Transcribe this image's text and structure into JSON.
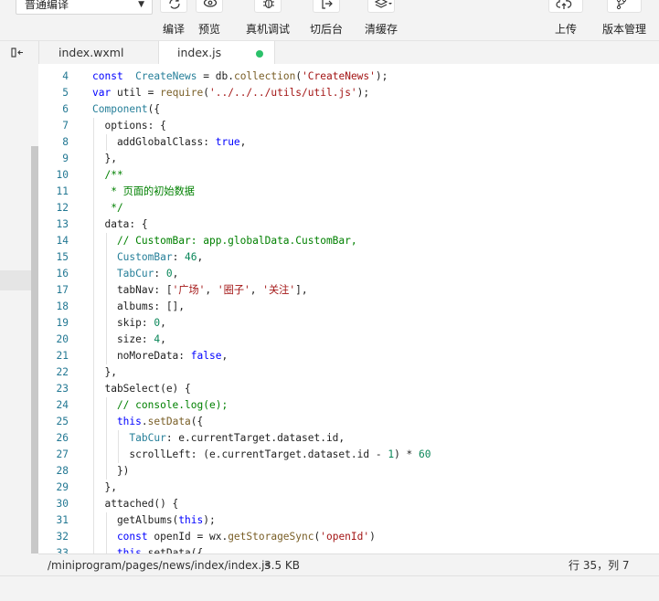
{
  "toolbar": {
    "compile_mode": "普通编译",
    "buttons": [
      {
        "id": "compile",
        "label": "编译",
        "icon": "refresh-icon"
      },
      {
        "id": "preview",
        "label": "预览",
        "icon": "eye-icon"
      },
      {
        "id": "remote_debug",
        "label": "真机调试",
        "icon": "bug-icon"
      },
      {
        "id": "background",
        "label": "切后台",
        "icon": "exit-icon"
      },
      {
        "id": "clear_cache",
        "label": "清缓存",
        "icon": "layers-icon"
      },
      {
        "id": "upload",
        "label": "上传",
        "icon": "cloud-upload-icon"
      },
      {
        "id": "version",
        "label": "版本管理",
        "icon": "branch-icon"
      }
    ]
  },
  "tabs": [
    {
      "name": "index.wxml",
      "active": false
    },
    {
      "name": "index.js",
      "active": true,
      "unsaved": true
    }
  ],
  "editor": {
    "lines": [
      {
        "n": "4",
        "indent": 0,
        "tokens": [
          [
            "kw",
            "const"
          ],
          [
            "",
            "  "
          ],
          [
            "cl",
            "CreateNews"
          ],
          [
            "",
            ""
          ],
          [
            "",
            " = db."
          ],
          [
            "fn",
            "collection"
          ],
          [
            "",
            "("
          ],
          [
            "str",
            "'CreateNews'"
          ],
          [
            "",
            ");"
          ]
        ]
      },
      {
        "n": "5",
        "indent": 0,
        "tokens": [
          [
            "kw",
            "var"
          ],
          [
            "",
            " util = "
          ],
          [
            "fn",
            "require"
          ],
          [
            "",
            "("
          ],
          [
            "str",
            "'../../../utils/util.js'"
          ],
          [
            "",
            ");"
          ]
        ]
      },
      {
        "n": "6",
        "indent": 0,
        "tokens": [
          [
            "cl",
            "Component"
          ],
          [
            "",
            "({"
          ]
        ]
      },
      {
        "n": "7",
        "indent": 1,
        "tokens": [
          [
            "",
            "  options: {"
          ]
        ]
      },
      {
        "n": "8",
        "indent": 2,
        "tokens": [
          [
            "",
            "    addGlobalClass: "
          ],
          [
            "kw",
            "true"
          ],
          [
            "",
            ","
          ]
        ]
      },
      {
        "n": "9",
        "indent": 1,
        "tokens": [
          [
            "",
            "  },"
          ]
        ]
      },
      {
        "n": "10",
        "indent": 1,
        "tokens": [
          [
            "cmt",
            "  /**"
          ]
        ]
      },
      {
        "n": "11",
        "indent": 1,
        "tokens": [
          [
            "cmt",
            "   * 页面的初始数据"
          ]
        ]
      },
      {
        "n": "12",
        "indent": 1,
        "tokens": [
          [
            "cmt",
            "   */"
          ]
        ]
      },
      {
        "n": "13",
        "indent": 1,
        "tokens": [
          [
            "",
            "  data: {"
          ]
        ]
      },
      {
        "n": "14",
        "indent": 2,
        "tokens": [
          [
            "cmt",
            "    // CustomBar: app.globalData.CustomBar,"
          ]
        ]
      },
      {
        "n": "15",
        "indent": 2,
        "tokens": [
          [
            "cl",
            "    CustomBar"
          ],
          [
            "",
            ": "
          ],
          [
            "num-v",
            "46"
          ],
          [
            "",
            ","
          ]
        ]
      },
      {
        "n": "16",
        "indent": 2,
        "tokens": [
          [
            "cl",
            "    TabCur"
          ],
          [
            "",
            ": "
          ],
          [
            "num-v",
            "0"
          ],
          [
            "",
            ","
          ]
        ]
      },
      {
        "n": "17",
        "indent": 2,
        "tokens": [
          [
            "",
            "    tabNav: ["
          ],
          [
            "str",
            "'广场'"
          ],
          [
            "",
            ", "
          ],
          [
            "str",
            "'圈子'"
          ],
          [
            "",
            ", "
          ],
          [
            "str",
            "'关注'"
          ],
          [
            "",
            "],"
          ]
        ]
      },
      {
        "n": "18",
        "indent": 2,
        "tokens": [
          [
            "",
            "    albums: [],"
          ]
        ]
      },
      {
        "n": "19",
        "indent": 2,
        "tokens": [
          [
            "",
            "    skip: "
          ],
          [
            "num-v",
            "0"
          ],
          [
            "",
            ","
          ]
        ]
      },
      {
        "n": "20",
        "indent": 2,
        "tokens": [
          [
            "",
            "    size: "
          ],
          [
            "num-v",
            "4"
          ],
          [
            "",
            ","
          ]
        ]
      },
      {
        "n": "21",
        "indent": 2,
        "tokens": [
          [
            "",
            "    noMoreData: "
          ],
          [
            "kw",
            "false"
          ],
          [
            "",
            ","
          ]
        ]
      },
      {
        "n": "22",
        "indent": 1,
        "tokens": [
          [
            "",
            "  },"
          ]
        ]
      },
      {
        "n": "23",
        "indent": 1,
        "tokens": [
          [
            "",
            "  tabSelect(e) {"
          ]
        ]
      },
      {
        "n": "24",
        "indent": 2,
        "tokens": [
          [
            "cmt",
            "    // console.log(e);"
          ]
        ]
      },
      {
        "n": "25",
        "indent": 2,
        "tokens": [
          [
            "kw",
            "    this"
          ],
          [
            "",
            "."
          ],
          [
            "fn",
            "setData"
          ],
          [
            "",
            "({"
          ]
        ]
      },
      {
        "n": "26",
        "indent": 3,
        "tokens": [
          [
            "cl",
            "      TabCur"
          ],
          [
            "",
            ": e.currentTarget.dataset.id,"
          ]
        ]
      },
      {
        "n": "27",
        "indent": 3,
        "tokens": [
          [
            "",
            "      scrollLeft: (e.currentTarget.dataset.id - "
          ],
          [
            "num-v",
            "1"
          ],
          [
            "",
            ") * "
          ],
          [
            "num-v",
            "60"
          ]
        ]
      },
      {
        "n": "28",
        "indent": 2,
        "tokens": [
          [
            "",
            "    })"
          ]
        ]
      },
      {
        "n": "29",
        "indent": 1,
        "tokens": [
          [
            "",
            "  },"
          ]
        ]
      },
      {
        "n": "30",
        "indent": 1,
        "tokens": [
          [
            "",
            "  attached() {"
          ]
        ]
      },
      {
        "n": "31",
        "indent": 2,
        "tokens": [
          [
            "",
            "    getAlbums("
          ],
          [
            "kw",
            "this"
          ],
          [
            "",
            ");"
          ]
        ]
      },
      {
        "n": "32",
        "indent": 2,
        "tokens": [
          [
            "kw",
            "    const"
          ],
          [
            "",
            " openId = wx."
          ],
          [
            "fn",
            "getStorageSync"
          ],
          [
            "",
            "("
          ],
          [
            "str",
            "'openId'"
          ],
          [
            "",
            ")"
          ]
        ]
      },
      {
        "n": "33",
        "indent": 2,
        "tokens": [
          [
            "kw",
            "    this"
          ],
          [
            "",
            ".setData({"
          ]
        ]
      }
    ]
  },
  "status": {
    "path": "/miniprogram/pages/news/index/index.js",
    "size": "3.5 KB",
    "cursor": "行 35，列 7"
  }
}
